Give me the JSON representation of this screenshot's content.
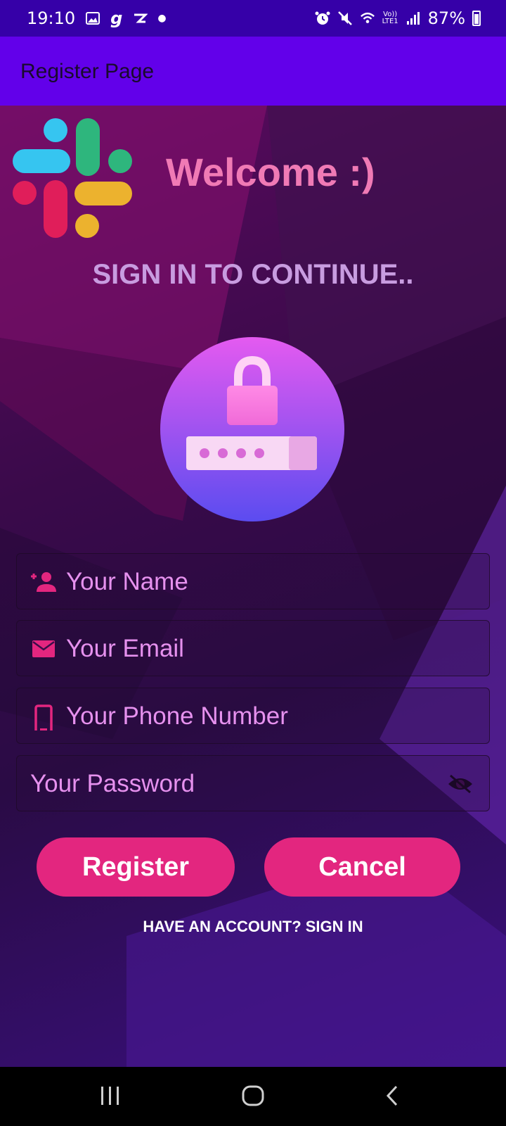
{
  "status_bar": {
    "time": "19:10",
    "lte_label_top": "Vo))",
    "lte_label_bottom": "LTE1",
    "battery": "87%"
  },
  "app_bar": {
    "title": "Register Page"
  },
  "header": {
    "welcome": "Welcome :)",
    "subtitle": "SIGN IN TO CONTINUE.."
  },
  "form": {
    "name_placeholder": "Your Name",
    "email_placeholder": "Your Email",
    "phone_placeholder": "Your Phone Number",
    "password_placeholder": "Your Password"
  },
  "buttons": {
    "register": "Register",
    "cancel": "Cancel"
  },
  "footer_link": "HAVE AN ACCOUNT? SIGN IN",
  "colors": {
    "status_bar": "#3600a8",
    "app_bar": "#6200ea",
    "accent": "#e3267f",
    "welcome_text": "#f07ab5",
    "input_text": "#e691ee"
  },
  "icons": {
    "gallery": "gallery-icon",
    "gpay": "g-icon",
    "nav_recent": "recent-apps-icon",
    "nav_home": "home-icon",
    "nav_back": "back-icon"
  }
}
